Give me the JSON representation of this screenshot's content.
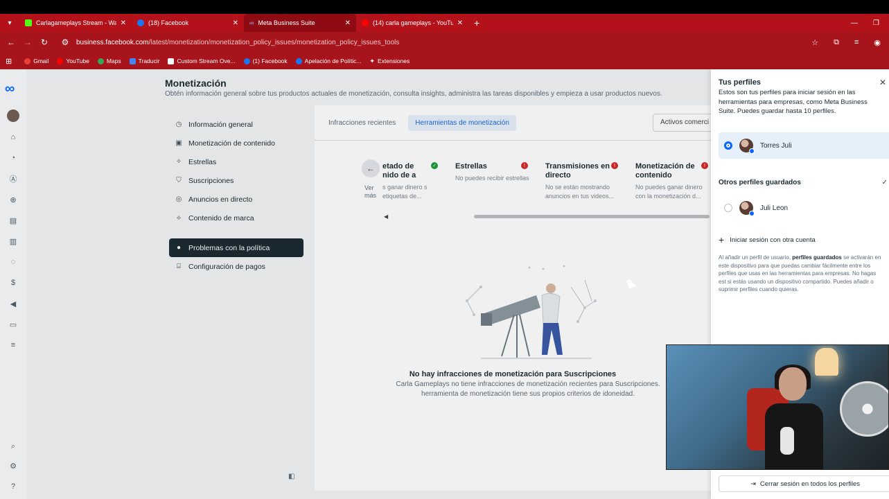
{
  "browser": {
    "tabs": [
      {
        "title": "Carlagameplays Stream - Watc",
        "fav_color": "#53fc18"
      },
      {
        "title": "(18) Facebook",
        "fav_color": "#1877f2"
      },
      {
        "title": "Meta Business Suite",
        "fav_color": "#0866ff",
        "active": true
      },
      {
        "title": "(14) carla gameplays - YouTube",
        "fav_color": "#ff0000"
      }
    ],
    "url_host": "business.facebook.com",
    "url_path": "/latest/monetization/monetization_policy_issues/monetization_policy_issues_tools",
    "bookmarks": [
      {
        "label": "Gmail",
        "color": "#ea4335"
      },
      {
        "label": "YouTube",
        "color": "#ff0000"
      },
      {
        "label": "Maps",
        "color": "#34a853"
      },
      {
        "label": "Traducir",
        "color": "#4285f4"
      },
      {
        "label": "Custom Stream Ove...",
        "color": "#ffffff"
      },
      {
        "label": "(1) Facebook",
        "color": "#1877f2"
      },
      {
        "label": "Apelación de Polític...",
        "color": "#1877f2"
      },
      {
        "label": "Extensiones",
        "color": "#ffffff"
      }
    ]
  },
  "header": {
    "title": "Monetización",
    "subtitle": "Obtén información general sobre tus productos actuales de monetización, consulta insights, administra las tareas disponibles y empieza a usar productos nuevos."
  },
  "menu": {
    "items": [
      {
        "label": "Información general",
        "icon": "gauge-icon"
      },
      {
        "label": "Monetización de contenido",
        "icon": "money-icon"
      },
      {
        "label": "Estrellas",
        "icon": "stars-icon"
      },
      {
        "label": "Suscripciones",
        "icon": "badge-icon"
      },
      {
        "label": "Anuncios en directo",
        "icon": "live-icon"
      },
      {
        "label": "Contenido de marca",
        "icon": "handshake-icon"
      }
    ],
    "policy_issues": "Problemas con la política",
    "payments": "Configuración de pagos"
  },
  "content": {
    "tabs": [
      "Infracciones recientes",
      "Herramientas de monetización"
    ],
    "assets_button": "Activos comerci",
    "ver_mas": "Ver más",
    "cards": [
      {
        "title": "etado de nido de a",
        "desc": "s ganar dinero s etiquetas de...",
        "status": "ok"
      },
      {
        "title": "Estrellas",
        "desc": "No puedes recibir estrellas",
        "status": "error"
      },
      {
        "title": "Transmisiones en directo",
        "desc": "No se están mostrando anuncios en tus videos...",
        "status": "error"
      },
      {
        "title": "Monetización de contenido",
        "desc": "No puedes ganar dinero con la monetización d...",
        "status": "error"
      }
    ],
    "empty_title": "No hay infracciones de monetización para Suscripciones",
    "empty_text_1": "Carla Gameplays no tiene infracciones de monetización recientes para Suscripciones.",
    "empty_text_2": "herramienta de monetización tiene sus propios criterios de idoneidad."
  },
  "panel": {
    "title": "Tus perfiles",
    "description": "Estos son tus perfiles para iniciar sesión en las herramientas para empresas, como Meta Business Suite. Puedes guardar hasta 10 perfiles.",
    "current_profile": "Torres Juli",
    "saved_title": "Otros perfiles guardados",
    "saved_profile": "Juli Leon",
    "add_account": "Iniciar sesión con otra cuenta",
    "note_pre": "Al añadir un perfil de usuario, ",
    "note_bold": "perfiles guardados",
    "note_post": " se activarán en este dispositivo para que puedas cambiar fácilmente entre los perfiles que usas en las herramientas para empresas. No hagas est si estás usando un dispositivo compartido. Puedes añadir o suprimir perfiles cuando quieras.",
    "logout_all": "Cerrar sesión en todos los perfiles"
  }
}
